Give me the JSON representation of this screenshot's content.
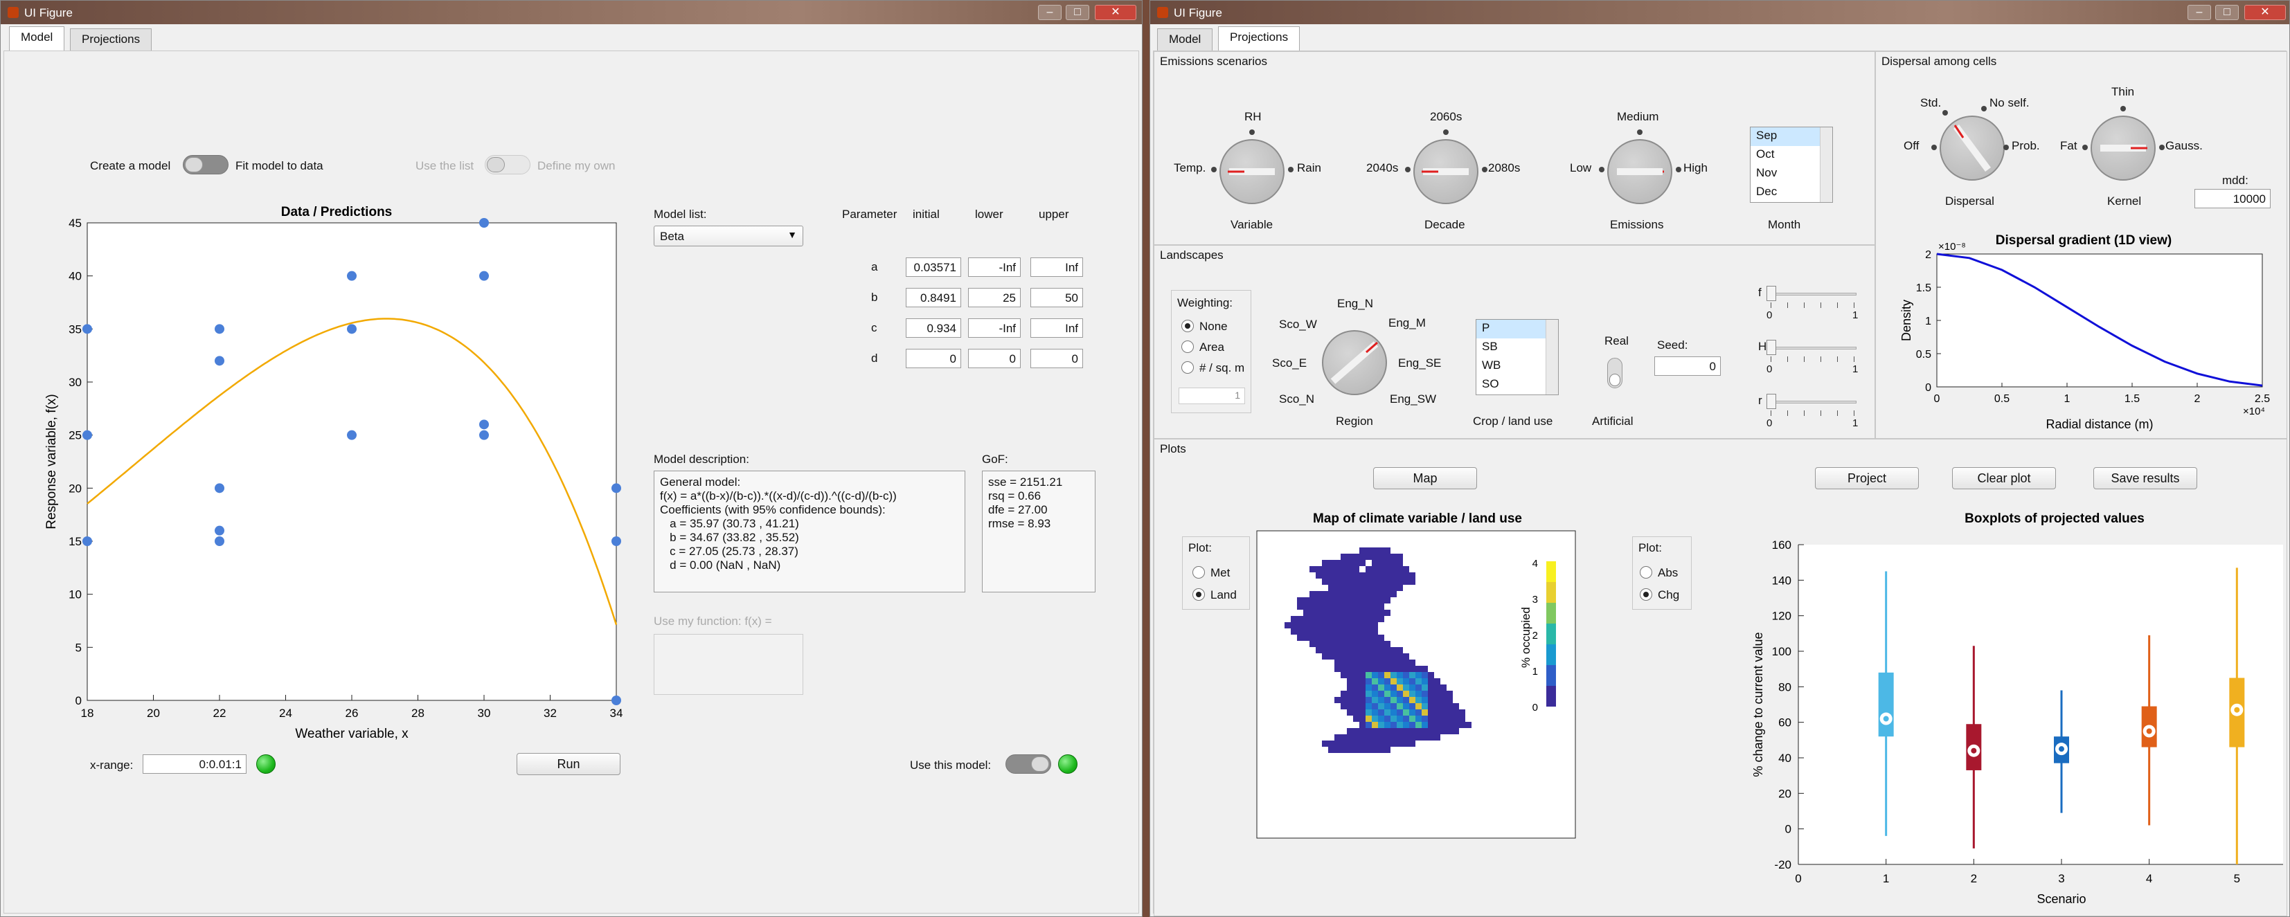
{
  "left_window": {
    "title": "UI Figure",
    "tabs": [
      "Model",
      "Projections"
    ],
    "active_tab": 0,
    "toggle1": {
      "left": "Create a model",
      "right": "Fit model to data"
    },
    "toggle2": {
      "left": "Use the list",
      "right": "Define my own"
    },
    "model_list_label": "Model list:",
    "model_selected": "Beta",
    "param_headers": [
      "Parameter",
      "initial",
      "lower",
      "upper"
    ],
    "params": [
      {
        "name": "a",
        "initial": "0.03571",
        "lower": "-Inf",
        "upper": "Inf"
      },
      {
        "name": "b",
        "initial": "0.8491",
        "lower": "25",
        "upper": "50"
      },
      {
        "name": "c",
        "initial": "0.934",
        "lower": "-Inf",
        "upper": "Inf"
      },
      {
        "name": "d",
        "initial": "0",
        "lower": "0",
        "upper": "0"
      }
    ],
    "model_desc_label": "Model description:",
    "model_desc": [
      "General model:",
      "f(x) = a*((b-x)/(b-c)).*((x-d)/(c-d)).^((c-d)/(b-c))",
      "",
      "Coefficients (with 95% confidence bounds):",
      "   a = 35.97 (30.73 , 41.21)",
      "   b = 34.67 (33.82 , 35.52)",
      "   c = 27.05 (25.73 , 28.37)",
      "   d = 0.00 (NaN , NaN)"
    ],
    "gof_label": "GoF:",
    "gof": [
      "sse = 2151.21",
      "rsq = 0.66",
      "dfe = 27.00",
      "rmse = 8.93"
    ],
    "myfun_label": "Use my function: f(x) =",
    "xrange_label": "x-range:",
    "xrange_value": "0:0.01:1",
    "run_label": "Run",
    "use_model_label": "Use this model:",
    "chart": {
      "title": "Data / Predictions",
      "xlabel": "Weather variable, x",
      "ylabel": "Response variable, f(x)"
    }
  },
  "chart_data": [
    {
      "type": "scatter",
      "title": "Data / Predictions",
      "xlabel": "Weather variable, x",
      "ylabel": "Response variable, f(x)",
      "xlim": [
        18,
        34
      ],
      "ylim": [
        0,
        45
      ],
      "xticks": [
        18,
        20,
        22,
        24,
        26,
        28,
        30,
        32,
        34
      ],
      "yticks": [
        0,
        5,
        10,
        15,
        20,
        25,
        30,
        35,
        40,
        45
      ],
      "points": [
        [
          18,
          35
        ],
        [
          18,
          25
        ],
        [
          18,
          15
        ],
        [
          22,
          35
        ],
        [
          22,
          32
        ],
        [
          22,
          20
        ],
        [
          22,
          16
        ],
        [
          22,
          15
        ],
        [
          26,
          40
        ],
        [
          26,
          35
        ],
        [
          26,
          25
        ],
        [
          30,
          45
        ],
        [
          30,
          40
        ],
        [
          30,
          26
        ],
        [
          30,
          25
        ],
        [
          34,
          20
        ],
        [
          34,
          15
        ],
        [
          34,
          0
        ]
      ],
      "fit_curve": {
        "model": "beta",
        "a": 35.97,
        "b": 34.67,
        "c": 27.05,
        "d": 0
      },
      "curve_color": "#f2a900",
      "point_color": "#4a7fd8"
    },
    {
      "type": "line",
      "title": "Dispersal gradient (1D view)",
      "xlabel": "Radial distance (m)",
      "ylabel": "Density",
      "x_exponent": "×10⁴",
      "y_exponent": "×10⁻⁸",
      "xlim": [
        0,
        2.5
      ],
      "ylim": [
        0,
        2
      ],
      "xticks": [
        0,
        0.5,
        1,
        1.5,
        2,
        2.5
      ],
      "yticks": [
        0,
        0.5,
        1,
        1.5,
        2
      ],
      "x": [
        0,
        0.25,
        0.5,
        0.75,
        1,
        1.25,
        1.5,
        1.75,
        2,
        2.25,
        2.5
      ],
      "y": [
        2.0,
        1.94,
        1.76,
        1.5,
        1.2,
        0.9,
        0.62,
        0.38,
        0.2,
        0.08,
        0.02
      ],
      "color": "#1010d8"
    },
    {
      "type": "box",
      "title": "Boxplots of projected values",
      "xlabel": "Scenario",
      "ylabel": "% change to current value",
      "xlim": [
        0,
        6
      ],
      "ylim": [
        -20,
        160
      ],
      "xticks": [
        0,
        1,
        2,
        3,
        4,
        5,
        6
      ],
      "yticks": [
        -20,
        0,
        20,
        40,
        60,
        80,
        100,
        120,
        140,
        160
      ],
      "boxes": [
        {
          "x": 1,
          "min": -4,
          "q1": 52,
          "median": 62,
          "q3": 88,
          "max": 145,
          "color": "#4cb8e6"
        },
        {
          "x": 2,
          "min": -11,
          "q1": 33,
          "median": 44,
          "q3": 59,
          "max": 103,
          "color": "#a8182e"
        },
        {
          "x": 3,
          "min": 9,
          "q1": 37,
          "median": 45,
          "q3": 52,
          "max": 78,
          "color": "#1a6cc0"
        },
        {
          "x": 4,
          "min": 2,
          "q1": 46,
          "median": 55,
          "q3": 69,
          "max": 109,
          "color": "#e06018"
        },
        {
          "x": 5,
          "min": -20,
          "q1": 46,
          "median": 67,
          "q3": 85,
          "max": 147,
          "color": "#f0b020"
        }
      ]
    },
    {
      "type": "heatmap",
      "title": "Map of climate variable / land use",
      "colorbar_label": "% occupied",
      "colorbar_ticks": [
        0,
        1,
        2,
        3,
        4
      ]
    }
  ],
  "right_window": {
    "title": "UI Figure",
    "tabs": [
      "Model",
      "Projections"
    ],
    "active_tab": 1,
    "emissions": {
      "title": "Emissions scenarios",
      "variable": {
        "top": "RH",
        "left": "Temp.",
        "right": "Rain",
        "label": "Variable"
      },
      "decade": {
        "top": "2060s",
        "left": "2040s",
        "right": "2080s",
        "label": "Decade"
      },
      "emis": {
        "top": "Medium",
        "left": "Low",
        "right": "High",
        "label": "Emissions"
      },
      "months": [
        "Sep",
        "Oct",
        "Nov",
        "Dec"
      ],
      "month_label": "Month"
    },
    "dispersal": {
      "title": "Dispersal among cells",
      "disp": {
        "top_left": "Std.",
        "top_right": "No self.",
        "left": "Off",
        "right": "Prob.",
        "label": "Dispersal"
      },
      "kernel": {
        "top": "Thin",
        "left": "Fat",
        "right": "Gauss.",
        "label": "Kernel"
      },
      "mdd_label": "mdd:",
      "mdd_value": "10000"
    },
    "landscapes": {
      "title": "Landscapes",
      "weighting_label": "Weighting:",
      "weighting": [
        "None",
        "Area",
        "# / sq. m"
      ],
      "weighting_selected": 0,
      "weight_value": "1",
      "region": {
        "labels": [
          "Eng_N",
          "Eng_M",
          "Eng_SE",
          "Eng_SW",
          "Sco_N",
          "Sco_E",
          "Sco_W"
        ],
        "label": "Region"
      },
      "crops": [
        "P",
        "SB",
        "WB",
        "SO"
      ],
      "crop_label": "Crop / land use",
      "artificial": {
        "top": "Real",
        "label": "Artificial"
      },
      "seed_label": "Seed:",
      "seed_value": "0",
      "sliders": [
        {
          "name": "f",
          "min": "0",
          "max": "1"
        },
        {
          "name": "H",
          "min": "0",
          "max": "1"
        },
        {
          "name": "r",
          "min": "0",
          "max": "1"
        }
      ]
    },
    "plots": {
      "title": "Plots",
      "map_btn": "Map",
      "project_btn": "Project",
      "clear_btn": "Clear plot",
      "save_btn": "Save results",
      "plot_left": {
        "label": "Plot:",
        "options": [
          "Met",
          "Land"
        ],
        "selected": 1
      },
      "plot_right": {
        "label": "Plot:",
        "options": [
          "Abs",
          "Chg"
        ],
        "selected": 1
      }
    }
  }
}
